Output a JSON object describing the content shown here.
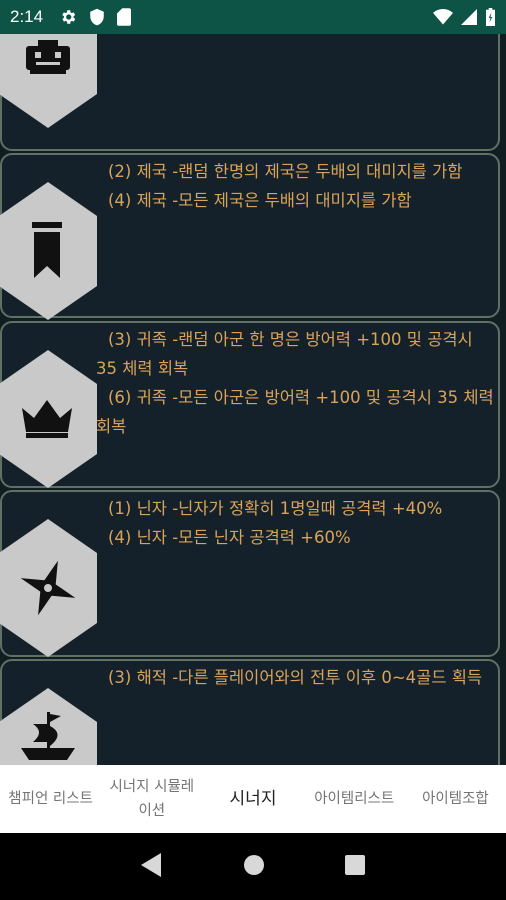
{
  "status_bar": {
    "time": "2:14"
  },
  "cards": [
    {
      "icon": "robot-icon",
      "lines": []
    },
    {
      "icon": "banner-icon",
      "lines": [
        "(2) 제국 -랜덤 한명의 제국은 두배의 대미지를 가함",
        "(4) 제국 -모든 제국은 두배의 대미지를 가함"
      ]
    },
    {
      "icon": "crown-icon",
      "lines": [
        "(3) 귀족 -랜덤 아군 한 명은 방어력 +100 및 공격시 35 체력 회복",
        "(6) 귀족 -모든 아군은 방어력 +100 및 공격시 35 체력 회복"
      ]
    },
    {
      "icon": "shuriken-icon",
      "lines": [
        "(1) 닌자 -닌자가 정확히 1명일때 공격력 +40%",
        "(4) 닌자 -모든 닌자 공격력 +60%"
      ]
    },
    {
      "icon": "pirate-ship-icon",
      "lines": [
        "(3) 해적 -다른 플레이어와의 전투 이후 0~4골드 획득"
      ]
    }
  ],
  "bottom_nav": {
    "tabs": [
      {
        "label": "챔피언 리스트"
      },
      {
        "label": "시너지 시뮬레이션"
      },
      {
        "label": "시너지"
      },
      {
        "label": "아이템리스트"
      },
      {
        "label": "아이템조합"
      }
    ],
    "active_index": 2
  },
  "colors": {
    "status_bar": "#0e5446",
    "card_text": "#d9a35a",
    "card_border": "#5f7065",
    "background": "#101e21",
    "hex": "#c9c9c9"
  }
}
